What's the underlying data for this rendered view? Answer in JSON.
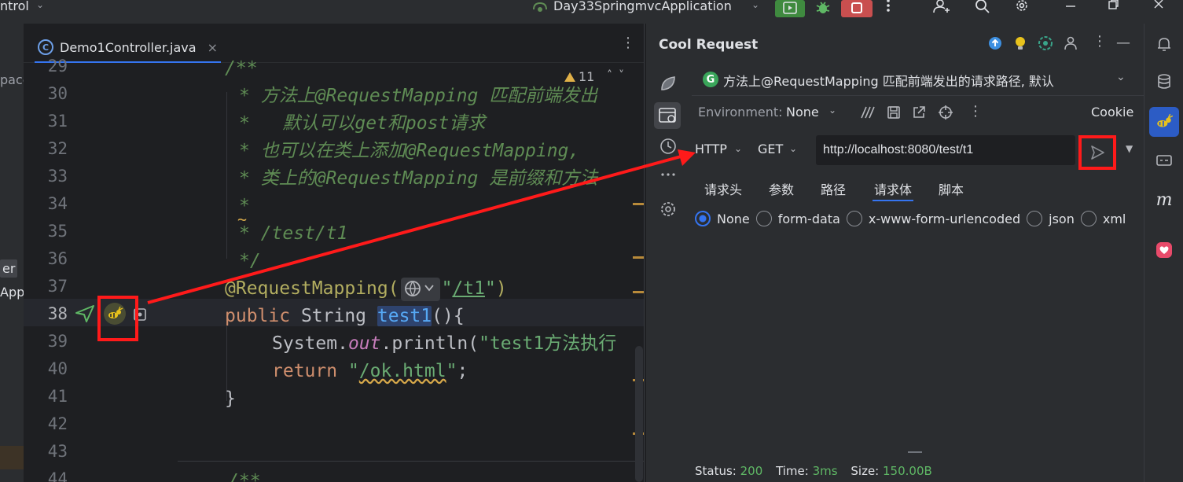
{
  "titlebar": {
    "project_fragment": "ntrol",
    "run_config": "Day33SpringmvcApplication"
  },
  "left_strip": {
    "fragment_1": "pace",
    "fragment_2": "er",
    "fragment_3": "App"
  },
  "editor": {
    "tab_label": "Demo1Controller.java",
    "tab_icon_letter": "C",
    "warning_count": "11",
    "line_numbers": [
      "29",
      "30",
      "31",
      "32",
      "33",
      "34",
      "35",
      "36",
      "37",
      "38",
      "39",
      "40",
      "41",
      "42",
      "43",
      "44"
    ],
    "code": {
      "l29": "/**",
      "l30": "* 方法上@RequestMapping 匹配前端发出",
      "l31": "*   默认可以get和post请求",
      "l32": "* 也可以在类上添加@RequestMapping,",
      "l33": "* 类上的@RequestMapping 是前缀和方法",
      "l34": "*",
      "l34_wave": "~",
      "l35": "* /test/t1",
      "l36": "*/",
      "l37_ann": "@RequestMapping(",
      "l37_str_q1": "\"",
      "l37_str_path": "/t1",
      "l37_str_q2": "\"",
      "l37_close": ")",
      "l38_kw": "public ",
      "l38_type": "String ",
      "l38_fn": "test1",
      "l38_rest": "(){",
      "l39_a": "System.",
      "l39_field": "out",
      "l39_b": ".println(",
      "l39_str": "\"test1方法执行",
      "l40_kw": "return ",
      "l40_q1": "\"",
      "l40_path": "/ok.html",
      "l40_q2": "\"",
      "l40_end": ";",
      "l41": "}",
      "l44": "/**"
    }
  },
  "cool_request": {
    "title": "Cool Request",
    "api_badge": "G",
    "api_text": "方法上@RequestMapping 匹配前端发出的请求路径, 默认",
    "environment_label": "Environment:",
    "environment_value": "None",
    "cookie_label": "Cookie",
    "protocol": "HTTP",
    "method": "GET",
    "url": "http://localhost:8080/test/t1",
    "tabs": [
      "请求头",
      "参数",
      "路径",
      "请求体",
      "脚本"
    ],
    "active_tab": "请求体",
    "body_types": [
      "None",
      "form-data",
      "x-www-form-urlencoded",
      "json",
      "xml"
    ],
    "selected_body_type": "None",
    "status": {
      "status_label": "Status:",
      "status_value": "200",
      "time_label": "Time:",
      "time_value": "3ms",
      "size_label": "Size:",
      "size_value": "150.00B"
    }
  },
  "right_strip": {
    "m_label": "m"
  },
  "colors": {
    "annotation": "#ff1a1a",
    "accent": "#3574f0",
    "status_ok": "#5fb865"
  }
}
